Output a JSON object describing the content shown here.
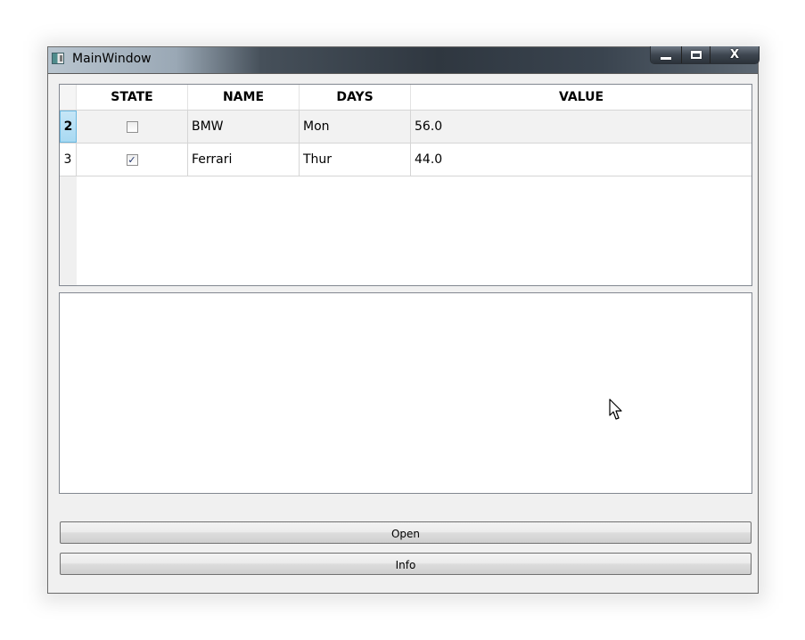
{
  "window": {
    "title": "MainWindow",
    "controls": {
      "minimize_icon": "minimize-icon",
      "maximize_icon": "maximize-icon",
      "close_label": "X"
    }
  },
  "table": {
    "headers": {
      "state": "STATE",
      "name": "NAME",
      "days": "DAYS",
      "value": "VALUE"
    },
    "rows": [
      {
        "row_number": "2",
        "selected": true,
        "state_checked": false,
        "name": "BMW",
        "days": "Mon",
        "value": "56.0"
      },
      {
        "row_number": "3",
        "selected": false,
        "state_checked": true,
        "name": "Ferrari",
        "days": "Thur",
        "value": "44.0"
      }
    ]
  },
  "text_area": {
    "value": ""
  },
  "buttons": {
    "open_label": "Open",
    "info_label": "Info"
  },
  "colors": {
    "selected_row_header": "#a8d9f2",
    "window_background": "#f0f0f0",
    "checkbox_check": "#21346b"
  }
}
